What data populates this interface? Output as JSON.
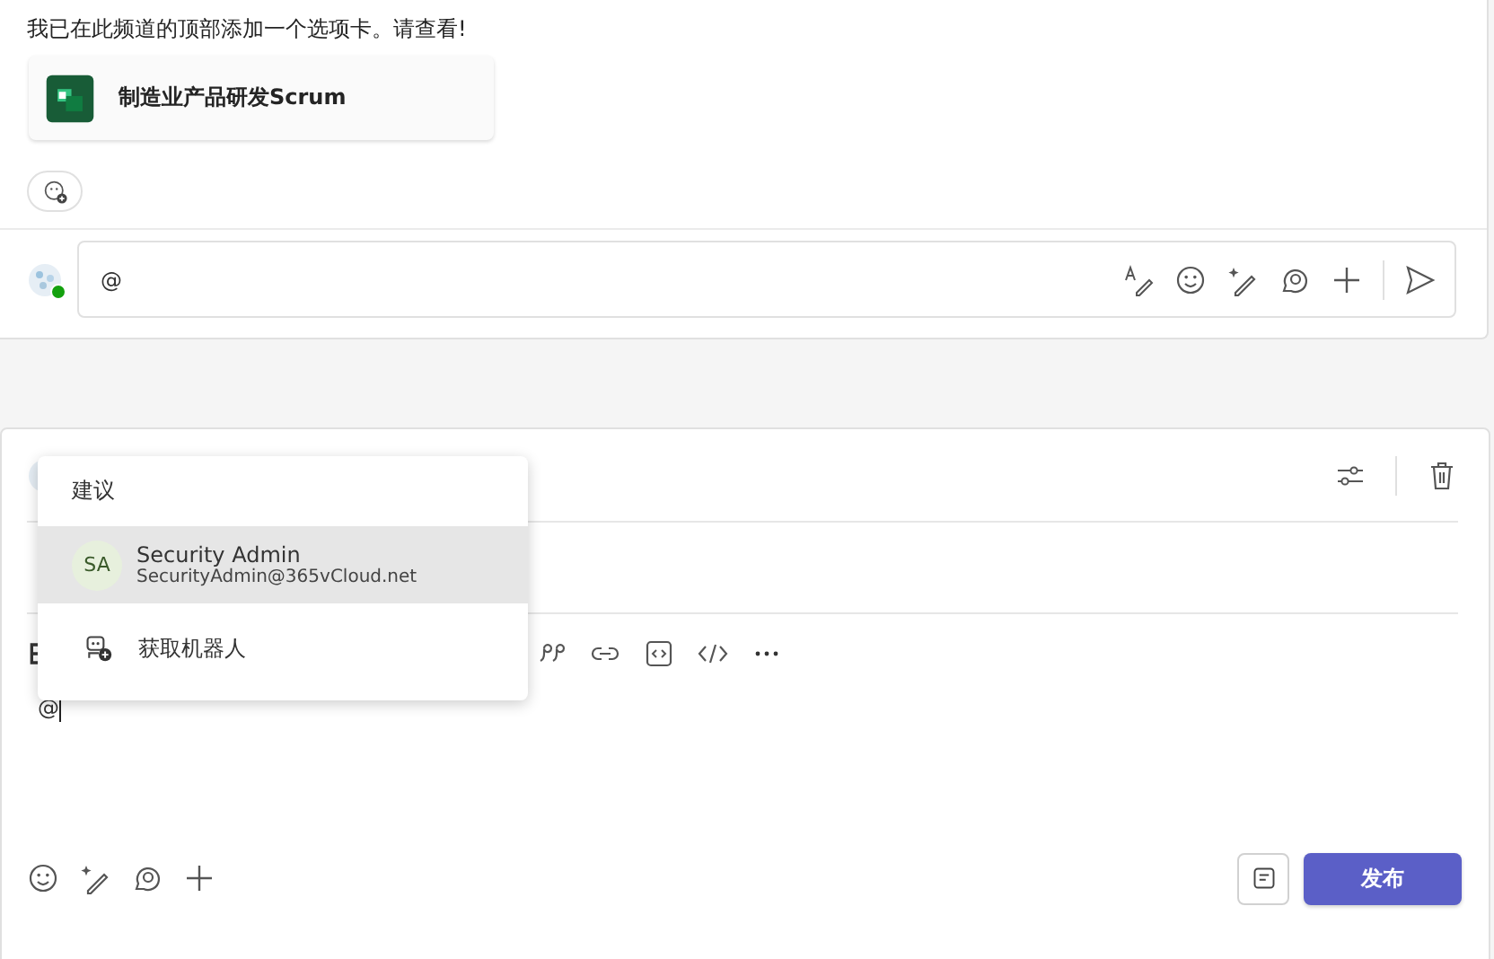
{
  "message": {
    "text": "我已在此频道的顶部添加一个选项卡。请查看!",
    "card": {
      "title": "制造业产品研发Scrum"
    }
  },
  "reply": {
    "value": "@",
    "online": true
  },
  "editor": {
    "body": "@"
  },
  "suggestions": {
    "heading": "建议",
    "items": [
      {
        "kind": "person",
        "initials": "SA",
        "name": "Security Admin",
        "email": "SecurityAdmin@365vCloud.net",
        "selected": true
      },
      {
        "kind": "bot",
        "name": "获取机器人",
        "selected": false
      }
    ]
  },
  "post_button": "发布"
}
